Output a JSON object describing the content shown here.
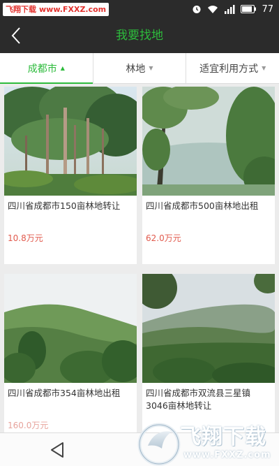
{
  "status_bar": {
    "watermark_site": "飞翔下载",
    "watermark_url": "www.FXXZ.com",
    "battery": "77",
    "icons": [
      "alarm-icon",
      "wifi-icon",
      "signal-icon",
      "battery-icon"
    ]
  },
  "header": {
    "title": "我要找地",
    "back_icon": "chevron-left-icon"
  },
  "filters": [
    {
      "label": "成都市",
      "active": true,
      "caret": "▲"
    },
    {
      "label": "林地",
      "active": false,
      "caret": "▼"
    },
    {
      "label": "适宜利用方式",
      "active": false,
      "caret": "▼"
    }
  ],
  "listings": [
    {
      "title": "四川省成都市150亩林地转让",
      "price": "10.8万元"
    },
    {
      "title": "四川省成都市500亩林地出租",
      "price": "62.0万元"
    },
    {
      "title": "四川省成都市354亩林地出租",
      "price": "160.0万元"
    },
    {
      "title": "四川省成都市双流县三星镇3046亩林地转让",
      "price": ""
    }
  ],
  "navbar": {
    "back_icon": "triangle-back-icon"
  },
  "watermark": {
    "text": "飞翔下载",
    "url": "www.FXXZ.com"
  },
  "colors": {
    "accent": "#2dbb3c",
    "price": "#e15a4d",
    "bar": "#2b2b2b"
  }
}
